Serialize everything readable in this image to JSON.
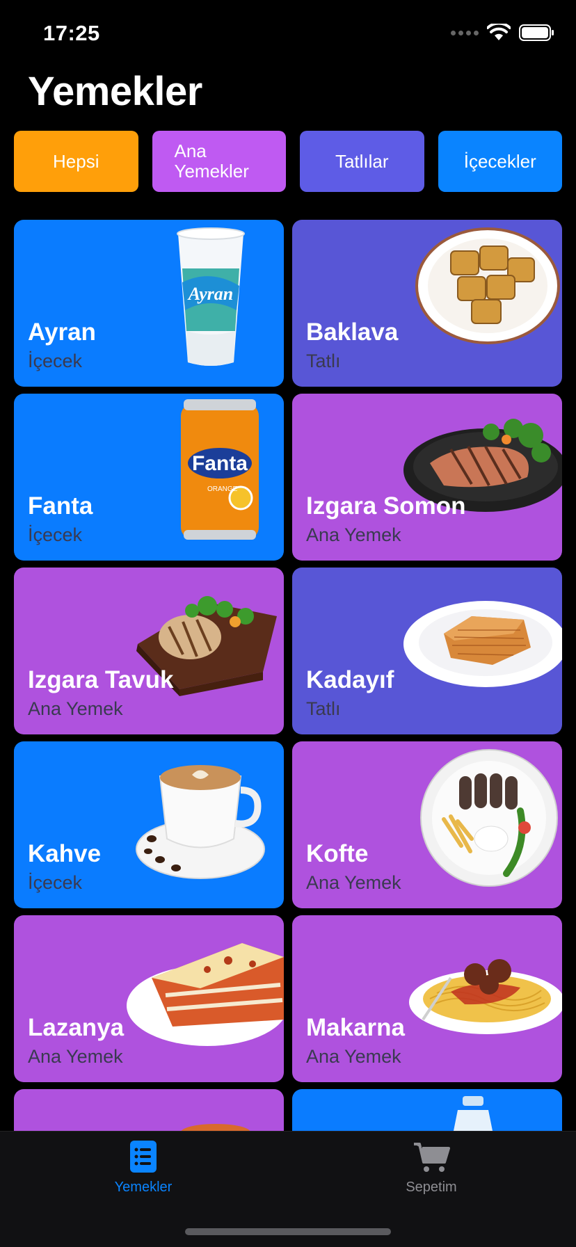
{
  "status_bar": {
    "time": "17:25"
  },
  "page": {
    "title": "Yemekler"
  },
  "filters": [
    {
      "label": "Hepsi",
      "color": "#FF9F0A"
    },
    {
      "label": "Ana Yemekler",
      "color": "#BF5AF2"
    },
    {
      "label": "Tatlılar",
      "color": "#5E5CE6"
    },
    {
      "label": "İçecekler",
      "color": "#0A84FF"
    }
  ],
  "items": [
    {
      "name": "Ayran",
      "category": "İçecek",
      "color": "#0A7CFF",
      "icon": "ayran-cup-icon"
    },
    {
      "name": "Baklava",
      "category": "Tatlı",
      "color": "#5856D6",
      "icon": "baklava-plate-icon"
    },
    {
      "name": "Fanta",
      "category": "İçecek",
      "color": "#0A7CFF",
      "icon": "fanta-can-icon"
    },
    {
      "name": "Izgara Somon",
      "category": "Ana Yemek",
      "color": "#AF52DE",
      "icon": "salmon-plate-icon"
    },
    {
      "name": "Izgara Tavuk",
      "category": "Ana Yemek",
      "color": "#AF52DE",
      "icon": "chicken-board-icon"
    },
    {
      "name": "Kadayıf",
      "category": "Tatlı",
      "color": "#5856D6",
      "icon": "kadayif-plate-icon"
    },
    {
      "name": "Kahve",
      "category": "İçecek",
      "color": "#0A7CFF",
      "icon": "coffee-cup-icon"
    },
    {
      "name": "Kofte",
      "category": "Ana Yemek",
      "color": "#AF52DE",
      "icon": "kofte-plate-icon"
    },
    {
      "name": "Lazanya",
      "category": "Ana Yemek",
      "color": "#AF52DE",
      "icon": "lasagna-plate-icon"
    },
    {
      "name": "Makarna",
      "category": "Ana Yemek",
      "color": "#AF52DE",
      "icon": "pasta-plate-icon"
    }
  ],
  "partial_items": [
    {
      "color": "#AF52DE",
      "icon": "food-plate-icon"
    },
    {
      "color": "#0A7CFF",
      "icon": "water-bottle-icon"
    }
  ],
  "tab_bar": {
    "tabs": [
      {
        "label": "Yemekler",
        "active": true,
        "icon": "list-icon"
      },
      {
        "label": "Sepetim",
        "active": false,
        "icon": "cart-icon"
      }
    ],
    "active_color": "#0A84FF",
    "inactive_color": "#8E8E93"
  }
}
